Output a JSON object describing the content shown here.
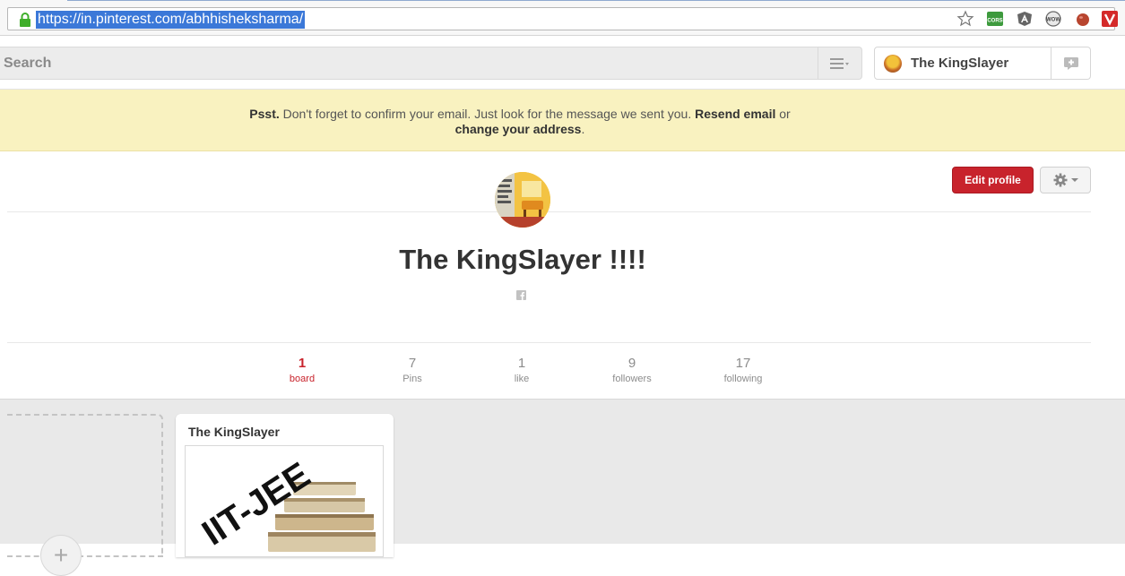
{
  "browser": {
    "url": "https://in.pinterest.com/abhhisheksharma/",
    "extensions": [
      {
        "name": "star-icon"
      },
      {
        "name": "cors-extension-icon",
        "label": "CORS"
      },
      {
        "name": "angular-extension-icon"
      },
      {
        "name": "wow-extension-icon",
        "label": "WOW"
      },
      {
        "name": "tomato-extension-icon"
      },
      {
        "name": "vivaldi-extension-icon"
      }
    ]
  },
  "header": {
    "search_placeholder": "Search",
    "user_name": "The KingSlayer"
  },
  "notice": {
    "bold_lead": "Psst.",
    "text1": " Don't forget to confirm your email. Just look for the message we sent you. ",
    "link_resend": "Resend email",
    "text2": " or ",
    "link_change": "change your address",
    "text3": "."
  },
  "profile": {
    "edit_label": "Edit profile",
    "name": "The KingSlayer !!!!",
    "stats": [
      {
        "num": "1",
        "label": "board"
      },
      {
        "num": "7",
        "label": "Pins"
      },
      {
        "num": "1",
        "label": "like"
      },
      {
        "num": "9",
        "label": "followers"
      },
      {
        "num": "17",
        "label": "following"
      }
    ]
  },
  "boards": {
    "create_symbol": "+",
    "items": [
      {
        "title": "The KingSlayer",
        "cover_text": "IIT-JEE"
      }
    ]
  },
  "colors": {
    "accent_red": "#c8232c",
    "notice_bg": "#f9f2c0",
    "url_highlight": "#3b78d8"
  }
}
